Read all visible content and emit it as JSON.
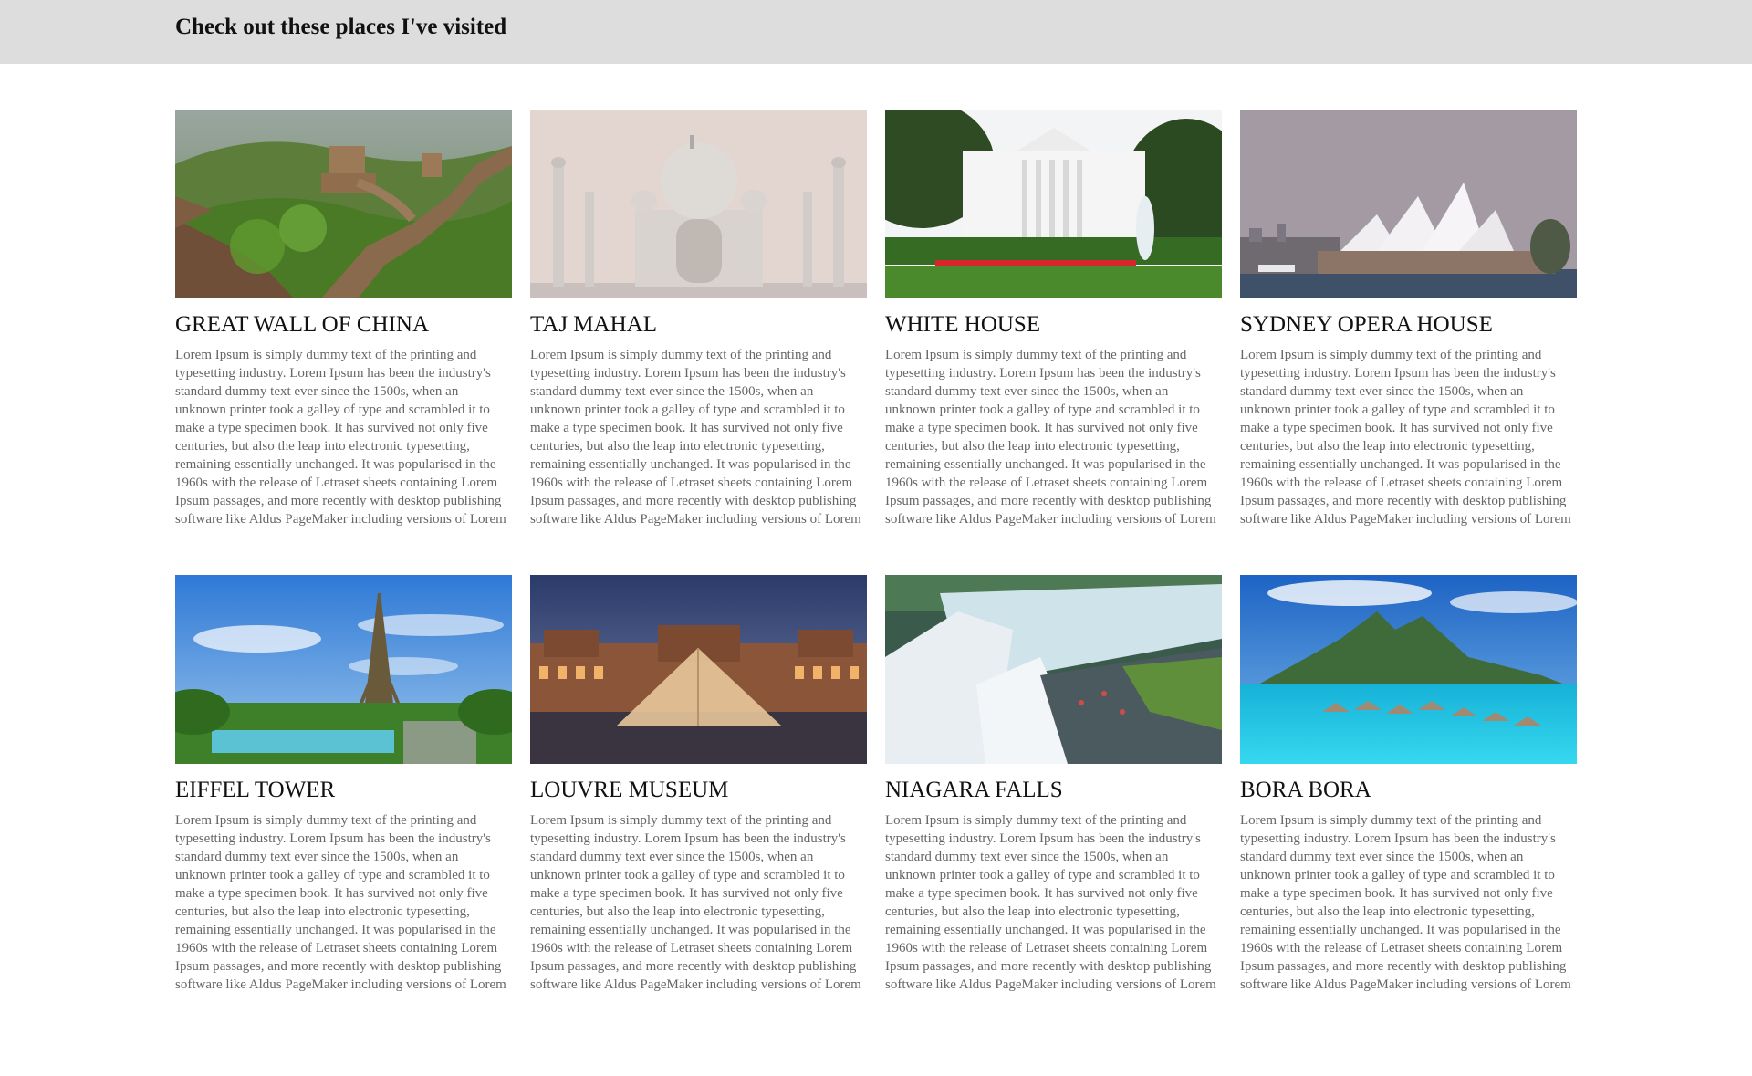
{
  "header": {
    "title": "Check out these places I've visited"
  },
  "places": [
    {
      "name": "GREAT WALL OF CHINA",
      "image": "great-wall-image",
      "description": "Lorem Ipsum is simply dummy text of the printing and typesetting industry. Lorem Ipsum has been the industry's standard dummy text ever since the 1500s, when an unknown printer took a galley of type and scrambled it to make a type specimen book. It has survived not only five centuries, but also the leap into electronic typesetting, remaining essentially unchanged. It was popularised in the 1960s with the release of Letraset sheets containing Lorem Ipsum passages, and more recently with desktop publishing software like Aldus PageMaker including versions of Lorem Ipsum."
    },
    {
      "name": "TAJ MAHAL",
      "image": "taj-mahal-image",
      "description": "Lorem Ipsum is simply dummy text of the printing and typesetting industry. Lorem Ipsum has been the industry's standard dummy text ever since the 1500s, when an unknown printer took a galley of type and scrambled it to make a type specimen book. It has survived not only five centuries, but also the leap into electronic typesetting, remaining essentially unchanged. It was popularised in the 1960s with the release of Letraset sheets containing Lorem Ipsum passages, and more recently with desktop publishing software like Aldus PageMaker including versions of Lorem Ipsum."
    },
    {
      "name": "WHITE HOUSE",
      "image": "white-house-image",
      "description": "Lorem Ipsum is simply dummy text of the printing and typesetting industry. Lorem Ipsum has been the industry's standard dummy text ever since the 1500s, when an unknown printer took a galley of type and scrambled it to make a type specimen book. It has survived not only five centuries, but also the leap into electronic typesetting, remaining essentially unchanged. It was popularised in the 1960s with the release of Letraset sheets containing Lorem Ipsum passages, and more recently with desktop publishing software like Aldus PageMaker including versions of Lorem Ipsum."
    },
    {
      "name": "SYDNEY OPERA HOUSE",
      "image": "sydney-opera-house-image",
      "description": "Lorem Ipsum is simply dummy text of the printing and typesetting industry. Lorem Ipsum has been the industry's standard dummy text ever since the 1500s, when an unknown printer took a galley of type and scrambled it to make a type specimen book. It has survived not only five centuries, but also the leap into electronic typesetting, remaining essentially unchanged. It was popularised in the 1960s with the release of Letraset sheets containing Lorem Ipsum passages, and more recently with desktop publishing software like Aldus PageMaker including versions of Lorem Ipsum."
    },
    {
      "name": "EIFFEL TOWER",
      "image": "eiffel-tower-image",
      "description": "Lorem Ipsum is simply dummy text of the printing and typesetting industry. Lorem Ipsum has been the industry's standard dummy text ever since the 1500s, when an unknown printer took a galley of type and scrambled it to make a type specimen book. It has survived not only five centuries, but also the leap into electronic typesetting, remaining essentially unchanged. It was popularised in the 1960s with the release of Letraset sheets containing Lorem Ipsum passages, and more recently with desktop publishing software like Aldus PageMaker including versions of Lorem Ipsum."
    },
    {
      "name": "LOUVRE MUSEUM",
      "image": "louvre-museum-image",
      "description": "Lorem Ipsum is simply dummy text of the printing and typesetting industry. Lorem Ipsum has been the industry's standard dummy text ever since the 1500s, when an unknown printer took a galley of type and scrambled it to make a type specimen book. It has survived not only five centuries, but also the leap into electronic typesetting, remaining essentially unchanged. It was popularised in the 1960s with the release of Letraset sheets containing Lorem Ipsum passages, and more recently with desktop publishing software like Aldus PageMaker including versions of Lorem Ipsum."
    },
    {
      "name": "NIAGARA FALLS",
      "image": "niagara-falls-image",
      "description": "Lorem Ipsum is simply dummy text of the printing and typesetting industry. Lorem Ipsum has been the industry's standard dummy text ever since the 1500s, when an unknown printer took a galley of type and scrambled it to make a type specimen book. It has survived not only five centuries, but also the leap into electronic typesetting, remaining essentially unchanged. It was popularised in the 1960s with the release of Letraset sheets containing Lorem Ipsum passages, and more recently with desktop publishing software like Aldus PageMaker including versions of Lorem Ipsum."
    },
    {
      "name": "BORA BORA",
      "image": "bora-bora-image",
      "description": "Lorem Ipsum is simply dummy text of the printing and typesetting industry. Lorem Ipsum has been the industry's standard dummy text ever since the 1500s, when an unknown printer took a galley of type and scrambled it to make a type specimen book. It has survived not only five centuries, but also the leap into electronic typesetting, remaining essentially unchanged. It was popularised in the 1960s with the release of Letraset sheets containing Lorem Ipsum passages, and more recently with desktop publishing software like Aldus PageMaker including versions of Lorem Ipsum."
    }
  ],
  "colors": {
    "header_bg": "#dddddd",
    "body_text": "#666666",
    "heading_text": "#111111"
  }
}
